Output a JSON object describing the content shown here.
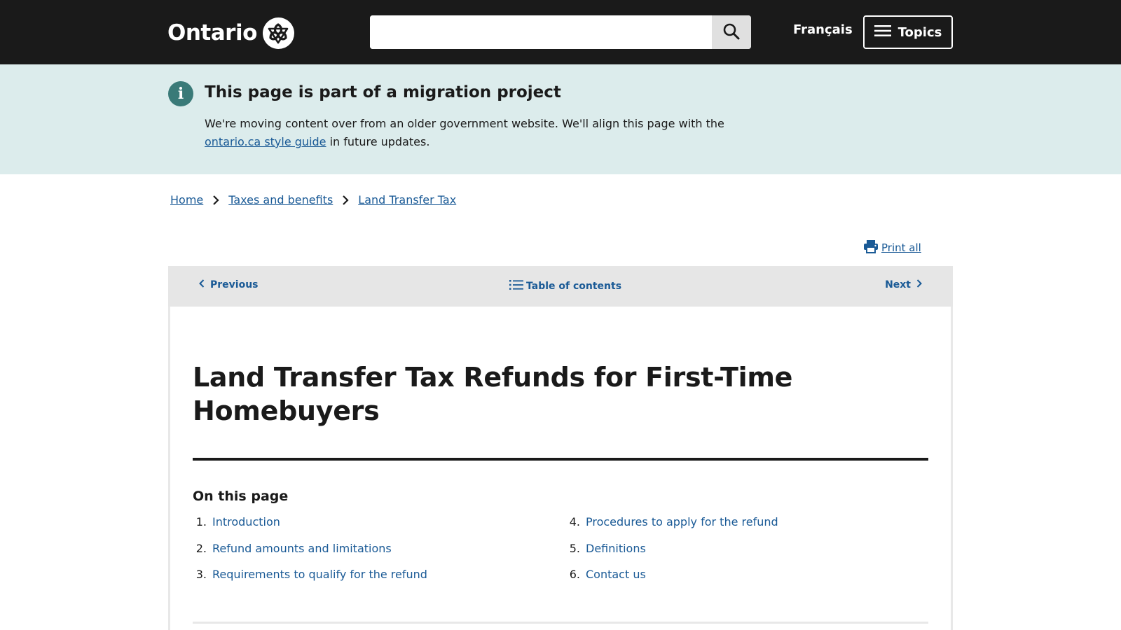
{
  "header": {
    "logo_text": "Ontario",
    "search_placeholder": "",
    "search_value": "",
    "language_link": "Français",
    "topics_button": "Topics"
  },
  "banner": {
    "title": "This page is part of a migration project",
    "text_before": "We're moving content over from an older government website. We'll align this page with the ",
    "link": "ontario.ca style guide",
    "text_after": " in future updates."
  },
  "breadcrumb": [
    {
      "label": "Home"
    },
    {
      "label": "Taxes and benefits"
    },
    {
      "label": "Land Transfer Tax"
    }
  ],
  "print_all": "Print all",
  "pager": {
    "previous": "Previous",
    "toc": "Table of contents",
    "next": "Next"
  },
  "page": {
    "title": "Land Transfer Tax Refunds for First-Time Homebuyers",
    "on_this_page": "On this page",
    "toc_left": [
      {
        "num": "1.",
        "label": "Introduction"
      },
      {
        "num": "2.",
        "label": "Refund amounts and limitations"
      },
      {
        "num": "3.",
        "label": "Requirements to qualify for the refund"
      }
    ],
    "toc_right": [
      {
        "num": "4.",
        "label": "Procedures to apply for the refund"
      },
      {
        "num": "5.",
        "label": "Definitions"
      },
      {
        "num": "6.",
        "label": "Contact us"
      }
    ]
  },
  "icons": {
    "logo": "trillium-icon",
    "search": "search-icon",
    "menu": "hamburger-icon",
    "info": "info-icon",
    "chevron": "chevron-right-icon",
    "print": "printer-icon",
    "list": "list-icon"
  },
  "colors": {
    "header_bg": "#1a1a1a",
    "banner_bg": "#dcecec",
    "info_icon": "#3a7a78",
    "link": "#1a5a96",
    "pager_bg": "#e6e6e6"
  }
}
